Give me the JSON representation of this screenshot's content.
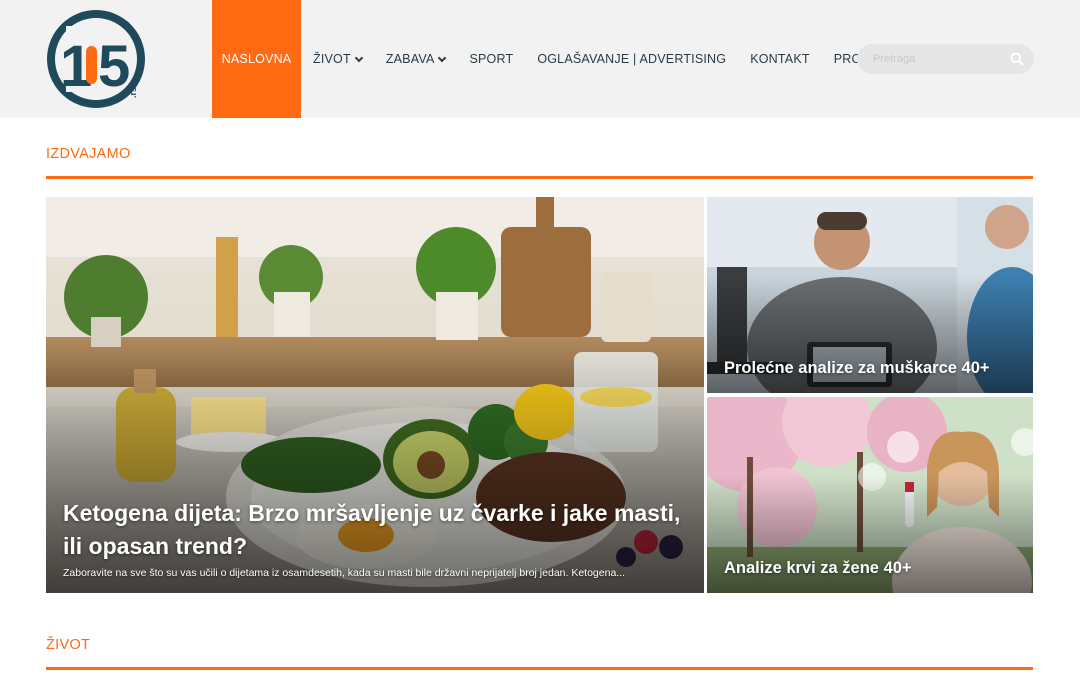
{
  "brand": {
    "logo_text": "105",
    "logo_suffix": ".rs",
    "accent": "#ff6a13",
    "navy": "#1e4a5c"
  },
  "nav": {
    "items": [
      {
        "label": "NASLOVNA",
        "active": true
      },
      {
        "label": "ŽIVOT",
        "dropdown": true
      },
      {
        "label": "ZABAVA",
        "dropdown": true
      },
      {
        "label": "SPORT"
      },
      {
        "label": "OGLAŠAVANJE | ADVERTISING"
      },
      {
        "label": "KONTAKT"
      },
      {
        "label": "PROMO"
      }
    ]
  },
  "search": {
    "placeholder": "Pretraga",
    "icon": "search-icon"
  },
  "sections": {
    "featured": "IZDVAJAMO",
    "life": "ŽIVOT"
  },
  "featured": {
    "main": {
      "title_line1": "Ketogena dijeta: Brzo mršavljenje uz čvarke i jake masti,",
      "title_line2": "ili opasan trend?",
      "excerpt": "Zaboravite na sve što su vas učili o dijetama iz osamdesetih, kada su masti bile državni neprijatelj broj jedan. Ketogena..."
    },
    "side_top": {
      "title": "Prolećne analize za muškarce 40+"
    },
    "side_bottom": {
      "title": "Analize krvi za žene 40+"
    }
  }
}
